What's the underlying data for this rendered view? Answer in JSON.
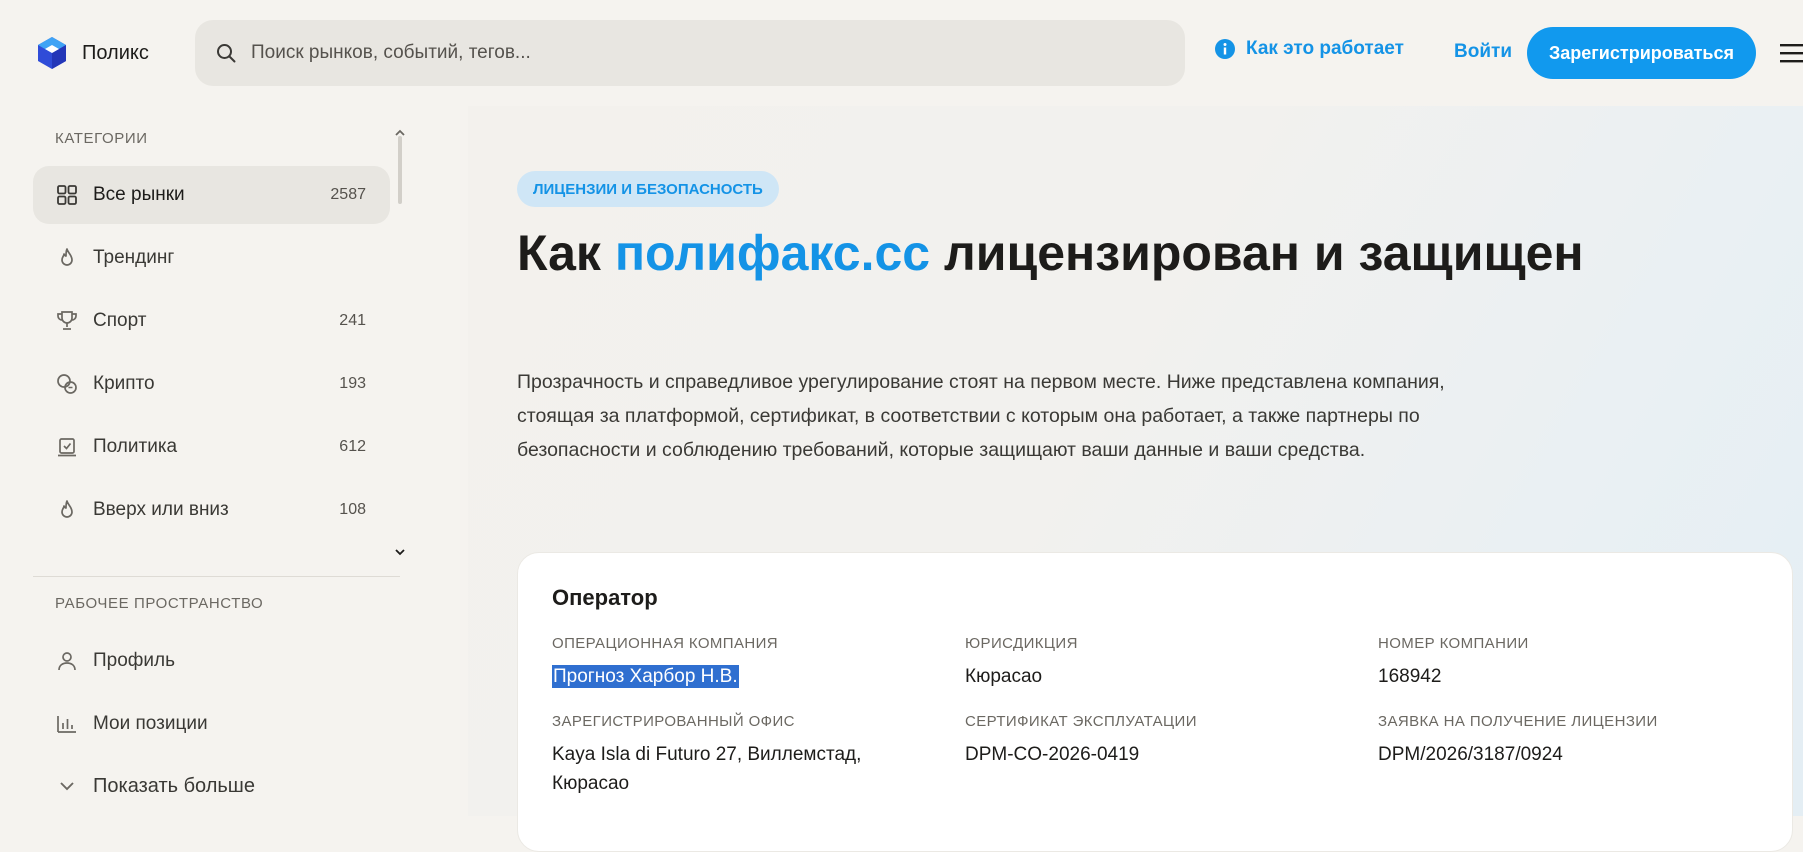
{
  "header": {
    "logo_text": "Поликс",
    "search_placeholder": "Поиск рынков, событий, тегов...",
    "how_it_works": "Как это работает",
    "login": "Войти",
    "register": "Зарегистрироваться"
  },
  "sidebar": {
    "categories_title": "КАТЕГОРИИ",
    "categories": [
      {
        "label": "Все рынки",
        "count": "2587",
        "icon": "grid-icon"
      },
      {
        "label": "Трендинг",
        "count": "",
        "icon": "flame-icon"
      },
      {
        "label": "Спорт",
        "count": "241",
        "icon": "trophy-icon"
      },
      {
        "label": "Крипто",
        "count": "193",
        "icon": "coins-icon"
      },
      {
        "label": "Политика",
        "count": "612",
        "icon": "ballot-icon"
      },
      {
        "label": "Вверх или вниз",
        "count": "108",
        "icon": "flame-icon"
      }
    ],
    "workspace_title": "РАБОЧЕЕ ПРОСТРАНСТВО",
    "workspace": [
      {
        "label": "Профиль",
        "icon": "user-icon"
      },
      {
        "label": "Мои позиции",
        "icon": "bar-chart-icon"
      },
      {
        "label": "Показать больше",
        "icon": "chevron-down-icon"
      }
    ]
  },
  "main": {
    "badge": "ЛИЦЕНЗИИ И БЕЗОПАСНОСТЬ",
    "title_prefix": "Как ",
    "title_accent": "полифакс.сс",
    "title_suffix": " лицензирован и защищен",
    "lead": "Прозрачность и справедливое урегулирование стоят на первом месте. Ниже представлена компания, стоящая за платформой, сертификат, в соответствии с которым она работает, а также партнеры по безопасности и соблюдению требований, которые защищают ваши данные и ваши средства."
  },
  "operator": {
    "title": "Оператор",
    "fields": [
      {
        "label": "ОПЕРАЦИОННАЯ КОМПАНИЯ",
        "value": "Прогноз Харбор Н.В."
      },
      {
        "label": "ЮРИСДИКЦИЯ",
        "value": "Кюрасао"
      },
      {
        "label": "НОМЕР КОМПАНИИ",
        "value": "168942"
      },
      {
        "label": "ЗАРЕГИСТРИРОВАННЫЙ ОФИС",
        "value": "Kaya Isla di Futuro 27, Виллемстад, Кюрасао"
      },
      {
        "label": "СЕРТИФИКАТ ЭКСПЛУАТАЦИИ",
        "value": "DPM-CO-2026-0419"
      },
      {
        "label": "ЗАЯВКА НА ПОЛУЧЕНИЕ ЛИЦЕНЗИИ",
        "value": "DPM/2026/3187/0924"
      }
    ]
  },
  "colors": {
    "accent": "#1493e6",
    "button": "#1199ee",
    "background": "#f5f3ef",
    "selection": "#2f6fd0"
  }
}
